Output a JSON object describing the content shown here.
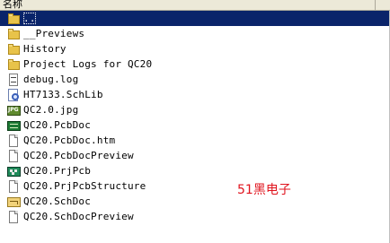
{
  "header": {
    "name_column": "名称"
  },
  "files": [
    {
      "name": "..",
      "icon": "folder-up-icon",
      "selected": true
    },
    {
      "name": "__Previews",
      "icon": "folder-icon"
    },
    {
      "name": "History",
      "icon": "folder-icon"
    },
    {
      "name": "Project Logs for QC20",
      "icon": "folder-icon"
    },
    {
      "name": "debug.log",
      "icon": "log-file-icon"
    },
    {
      "name": "HT7133.SchLib",
      "icon": "schlib-file-icon"
    },
    {
      "name": "QC2.0.jpg",
      "icon": "jpg-file-icon"
    },
    {
      "name": "QC20.PcbDoc",
      "icon": "pcbdoc-file-icon"
    },
    {
      "name": "QC20.PcbDoc.htm",
      "icon": "document-icon"
    },
    {
      "name": "QC20.PcbDocPreview",
      "icon": "document-icon"
    },
    {
      "name": "QC20.PrjPcb",
      "icon": "prjpcb-file-icon"
    },
    {
      "name": "QC20.PrjPcbStructure",
      "icon": "document-icon"
    },
    {
      "name": "QC20.SchDoc",
      "icon": "schdoc-file-icon"
    },
    {
      "name": "QC20.SchDocPreview",
      "icon": "document-icon"
    }
  ],
  "watermark": "51黑电子",
  "colors": {
    "selection": "#0a246a",
    "watermark": "#e0141e",
    "header_bg": "#ece9d8"
  }
}
